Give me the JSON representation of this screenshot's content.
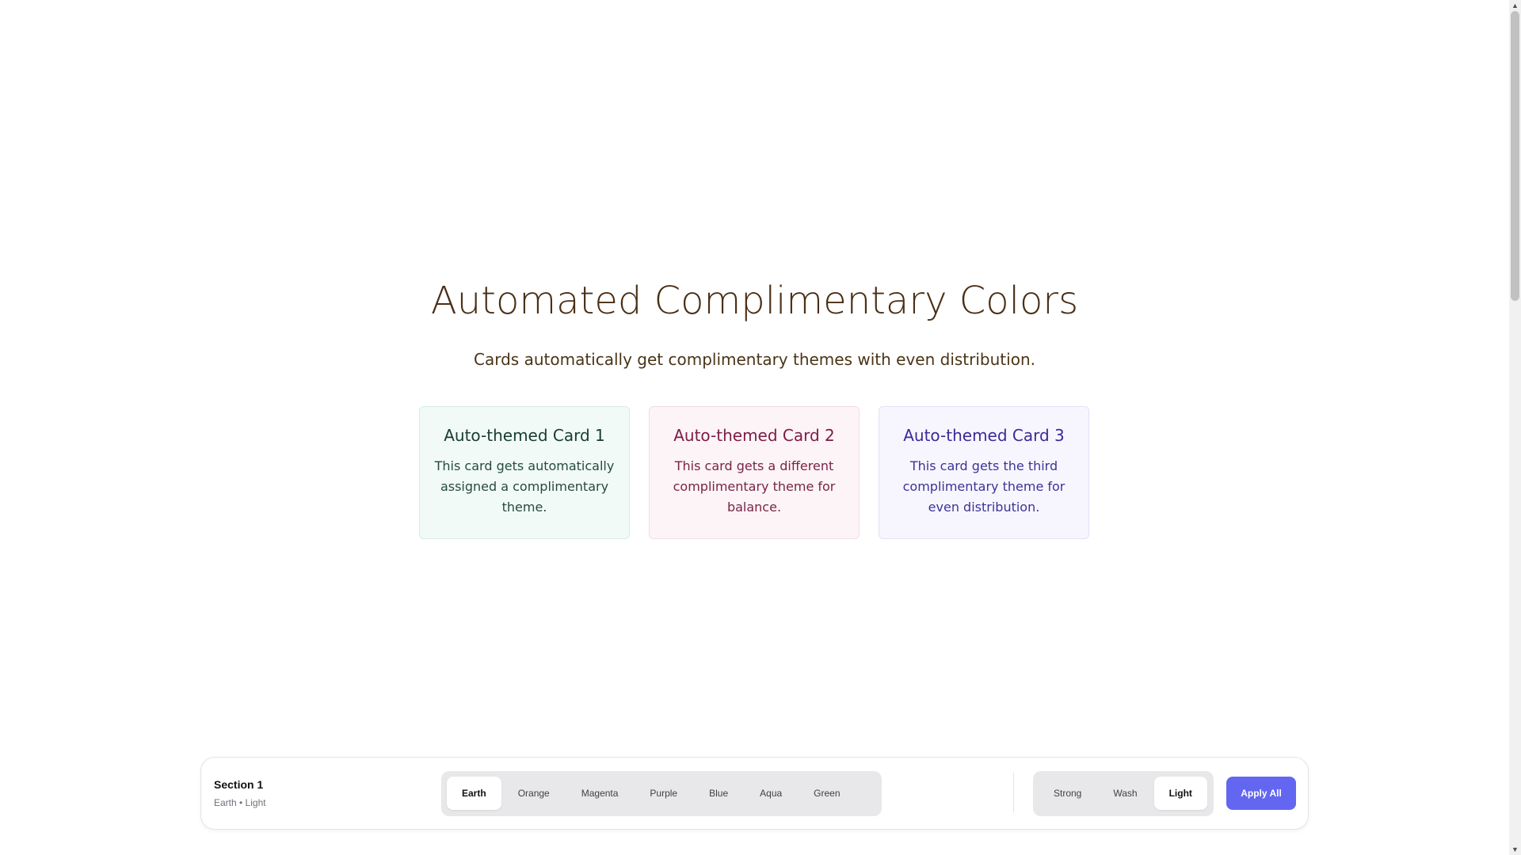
{
  "hero": {
    "title": "Automated Complimentary Colors",
    "subtitle": "Cards automatically get complimentary themes with even distribution."
  },
  "cards": [
    {
      "title": "Auto-themed Card 1",
      "body": "This card gets automatically assigned a complimentary theme."
    },
    {
      "title": "Auto-themed Card 2",
      "body": "This card gets a different complimentary theme for balance."
    },
    {
      "title": "Auto-themed Card 3",
      "body": "This card gets the third complimentary theme for even distribution."
    }
  ],
  "toolbar": {
    "section_title": "Section 1",
    "section_subtitle": "Earth • Light",
    "colors": [
      "Earth",
      "Orange",
      "Magenta",
      "Purple",
      "Blue",
      "Aqua",
      "Green"
    ],
    "selected_color": "Earth",
    "tones": [
      "Strong",
      "Wash",
      "Light"
    ],
    "selected_tone": "Light",
    "apply_label": "Apply All"
  },
  "colors": {
    "accent": "#6366f1",
    "title_text": "#4a2f16",
    "card1_accent": "#173d32",
    "card2_accent": "#7e1b46",
    "card3_accent": "#3a2a96"
  },
  "icons": {
    "scroll_up": "triangle-up-icon",
    "scroll_down": "triangle-down-icon"
  }
}
